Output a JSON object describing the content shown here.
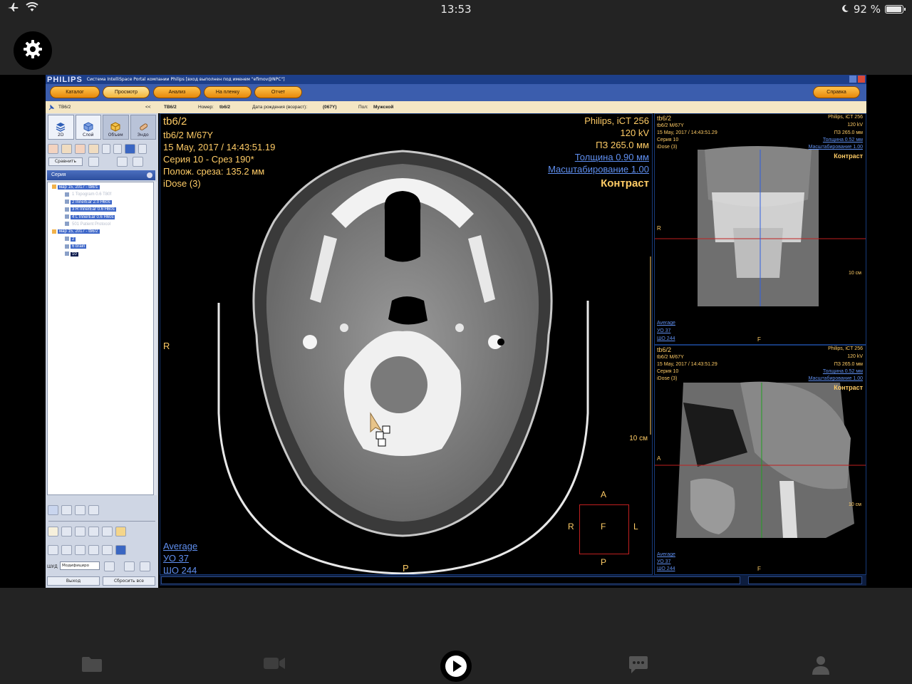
{
  "statusbar": {
    "time": "13:53",
    "battery": "92 %"
  },
  "app": {
    "brand": "PHILIPS",
    "window_title": "Система IntelliSpace Portal компании Philips [вход выполнен под именем \"efimov@NPC\"]",
    "toolbar": {
      "catalog": "Каталог",
      "viewing": "Просмотр",
      "analysis": "Анализ",
      "film": "На пленку",
      "report": "Отчет",
      "help": "Справка"
    },
    "patient": {
      "tab": "ТВ6/2",
      "collapse": "<<",
      "name": "ТВ6/2",
      "number_label": "Номер:",
      "number": "tb6/2",
      "dob_label": "Дата рождения (возраст):",
      "dob": "(067Y)",
      "sex_label": "Пол:",
      "sex": "Мужской"
    },
    "left": {
      "modes": [
        "2D",
        "Слой",
        "Объем",
        "Эндо"
      ],
      "compare": "Сравнить",
      "series_title": "Серия",
      "tree": [
        {
          "label": "мар 15, 2017 - tb6/1",
          "indent": 0,
          "state": "normal"
        },
        {
          "label": "1  Topogram  0.6  T80f",
          "indent": 2,
          "state": "dim"
        },
        {
          "label": "2  InnerEar  2.0  H60s",
          "indent": 2,
          "state": "normal"
        },
        {
          "label": "3  R  InnerEar  0.6  H60s",
          "indent": 2,
          "state": "normal"
        },
        {
          "label": "4  L  InnerEar  0.6  H60s",
          "indent": 2,
          "state": "normal"
        },
        {
          "label": "501  Patient Protocol",
          "indent": 2,
          "state": "dim"
        },
        {
          "label": "мар 15, 2017 - tb6/2",
          "indent": 0,
          "state": "normal"
        },
        {
          "label": "2",
          "indent": 2,
          "state": "normal"
        },
        {
          "label": "6  brain",
          "indent": 2,
          "state": "normal"
        },
        {
          "label": "10",
          "indent": 2,
          "state": "sel"
        }
      ],
      "shd_label": "ШУД",
      "shd_value": "Модифициро",
      "exit": "Выход",
      "reset_all": "Сбросить все"
    },
    "main_vp": {
      "patient_id": "tb6/2",
      "patient_info": "tb6/2 M/67Y",
      "datetime": "15 May, 2017 / 14:43:51.19",
      "series": "Серия 10 - Срез 190*",
      "slice_pos": "Полож. среза: 135.2 мм",
      "idose": "iDose (3)",
      "scanner": "Philips, iCT 256",
      "kv": "120 kV",
      "fov": "ПЗ 265.0 мм",
      "thickness": "Толщина 0.90 мм",
      "zoom": "Масштабирование 1.00",
      "contrast": "Контраст",
      "orient_right": "R",
      "orient_posterior": "P",
      "scale_label": "10 см",
      "window_preset": "Average",
      "wl": "УО    37",
      "ww": "ШО   244",
      "cube": {
        "top": "A",
        "left": "R",
        "center": "F",
        "right": "L",
        "bottom": "P"
      }
    },
    "coronal_vp": {
      "patient_id": "tb6/2",
      "patient_info": "tb6/2 M/67Y",
      "datetime": "15 May, 2017 / 14:43:51.29",
      "series": "Серия 10",
      "idose": "iDose (3)",
      "scanner": "Philips, iCT 256",
      "kv": "120 kV",
      "fov": "ПЗ 265.0 мм",
      "thickness": "Толщина 0.52 мм",
      "zoom": "Масштабирование 1.00",
      "contrast": "Контраст",
      "orient_right": "R",
      "orient_bottom": "F",
      "scale_label": "10 см",
      "window_preset": "Average",
      "wl": "УО    37",
      "ww": "ШО   244"
    },
    "sagittal_vp": {
      "patient_id": "tb6/2",
      "patient_info": "tb6/2 M/67Y",
      "datetime": "15 May, 2017 / 14:43:51.29",
      "series": "Серия 10",
      "idose": "iDose (3)",
      "scanner": "Philips, iCT 256",
      "kv": "120 kV",
      "fov": "ПЗ 265.0 мм",
      "thickness": "Толщина 0.52 мм",
      "zoom": "Масштабирование 1.00",
      "contrast": "Контраст",
      "orient_anterior": "A",
      "orient_bottom": "F",
      "scale_label": "10 см",
      "window_preset": "Average",
      "wl": "УО    37",
      "ww": "ШО   244"
    }
  },
  "icons": {
    "airplane": "airplane-icon",
    "wifi": "wifi-icon",
    "moon": "moon-icon",
    "settings": "gear-icon",
    "folder": "folder-icon",
    "camera": "video-camera-icon",
    "play": "play-icon",
    "chat": "chat-icon",
    "user": "user-icon"
  }
}
